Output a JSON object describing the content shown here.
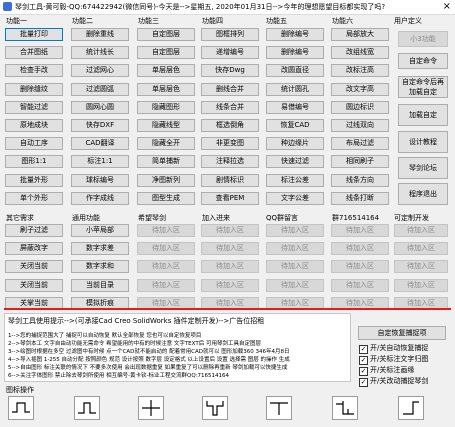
{
  "window": {
    "title": "琴剑工具-黄可毅-QQ:674422942(微信同号)-今天是-->星期五, 2020年01月31日-->今年的理想愿望目标都实现了吗?",
    "close_glyph": "×"
  },
  "groups": {
    "g1": "功能一",
    "g2": "功能二",
    "g3": "功能三",
    "g4": "功能四",
    "g5": "功能五",
    "g6": "功能六",
    "g7": "用户定义"
  },
  "col1": [
    "批量打印",
    "合并图纸",
    "检查手改",
    "删除缝纹",
    "智能过滤",
    "原地成块",
    "自动工序",
    "图形1:1",
    "批量外形",
    "单个外形"
  ],
  "col2": [
    "删除重线",
    "统计线长",
    "过滤网心",
    "过滤圆弧",
    "圆网心圆",
    "快存DXF",
    "CAD翻译",
    "标注1:1",
    "球标编号",
    "作字成线"
  ],
  "col3": [
    "自定图层",
    "自定图层",
    "单层层色",
    "单层层色",
    "隐藏图形",
    "隐藏线型",
    "隐藏全开",
    "简单捕新",
    "净图新列",
    "图型生成"
  ],
  "col4": [
    "图框排列",
    "递增编号",
    "快存Dwg",
    "删线合并",
    "线条合并",
    "框选倒角",
    "非更变图",
    "注释拉选",
    "剧情标识",
    "查看PEM"
  ],
  "col5": [
    "删除编号",
    "删除编号",
    "改圆直径",
    "统计圆孔",
    "易借编号",
    "恢复CAD",
    "种边缘片",
    "快速过滤",
    "标注公差",
    "文字公差"
  ],
  "col6": [
    "局部放大",
    "改组线宽",
    "改标注高",
    "改文字高",
    "圆边标识",
    "过线双向",
    "布局过滤",
    "相同刷子",
    "线条方向",
    "线条打断"
  ],
  "user": {
    "b1": "小3功能",
    "b2": "自定命令",
    "b3": "自定命令后再加载自定",
    "b4": "加载自定",
    "b5": "设计教程",
    "b6": "琴剑论坛",
    "b7": "程序退出"
  },
  "groups2": {
    "h1": "其它需求",
    "h2": "通用功能",
    "h3": "希望琴剑",
    "h4": "加入进来",
    "h5": "QQ群留言",
    "h6": "群716514164",
    "h7": "可定制开发"
  },
  "other": [
    "刷子过滤",
    "屏蔽改字",
    "关闭当前",
    "关闭当前",
    "关掌当前"
  ],
  "common": [
    "小苹局部",
    "数字求差",
    "数字求和",
    "当前目录",
    "模拟折痕"
  ],
  "placeholder": "待加入区",
  "usage": {
    "title": "琴剑工具使用提示-->(可承接Cad Creo SolidWorks 插件定制开发)-->广告位招租",
    "lines": [
      "1-->您的捕捉范围大了 捕捉可以自动恢复 默认全部恢复 您也可以自定恢复项目",
      "2-->琴剑本工 文字自由动功能无需命令 希望能用的中有的时候注意 文字TEXT后 可用琴剑工具自定图层",
      "3-->绘图时根据在多空 过滤图中有时候 点一个CAD就不能启动的 配着常用CAD就可以 图形加载360 346年4月8日",
      "4-->导入插图 1-255 自动分配 按照颜色 规范 设计按照 数字层 设定格式 以上设置后 设置 选择需 图层 的操作 生成",
      "5-->自由图形 标注关联的情况下 不要多次使用 会出现数据重复 如果重复了可以删除再重新 琴剑加载可以快捷生成",
      "6-->关注字体图形 禁止除去琴剑所使用 相互编号-黄卡钦-标业工程交流群QQ:716514164"
    ]
  },
  "restore_button": "自定恢复捕捉项",
  "checks": [
    {
      "label": "开/关自动恢复捕捉",
      "checked": true
    },
    {
      "label": "开/关标注文字归图",
      "checked": true
    },
    {
      "label": "开/关标注画缘",
      "checked": true
    },
    {
      "label": "开/关改动捕捉琴剑",
      "checked": true
    }
  ],
  "shapes_label": "图标操作"
}
